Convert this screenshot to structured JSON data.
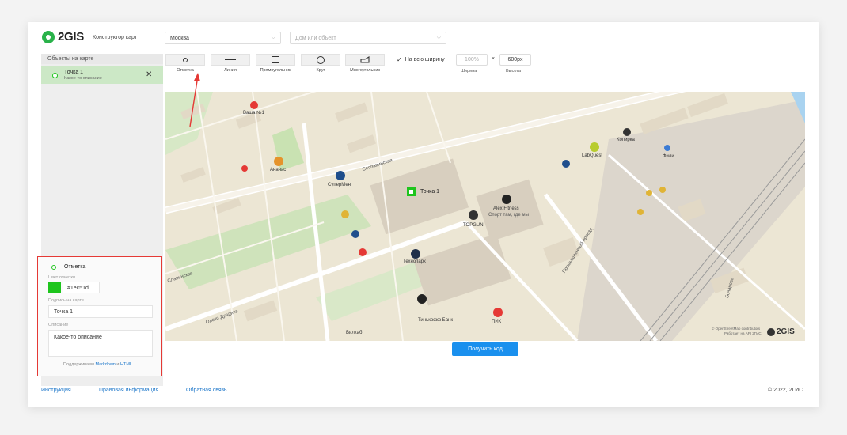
{
  "header": {
    "logo": "2GIS",
    "subtitle": "Конструктор карт",
    "city": "Москва",
    "search_placeholder": "Дом или объект"
  },
  "sidebar": {
    "title": "Объекты на карте",
    "items": [
      {
        "title": "Точка 1",
        "description": "Какое-то описание"
      }
    ]
  },
  "tools": [
    {
      "label": "Отметка",
      "icon": "circle-dot-icon"
    },
    {
      "label": "Линия",
      "icon": "line-icon"
    },
    {
      "label": "Прямоугольник",
      "icon": "square-icon"
    },
    {
      "label": "Круг",
      "icon": "circle-icon"
    },
    {
      "label": "Многоугольник",
      "icon": "polygon-icon"
    }
  ],
  "size": {
    "full_width_label": "На всю ширину",
    "width_value": "100%",
    "times": "×",
    "height_value": "600px",
    "width_label": "Ширина",
    "height_label": "Высота"
  },
  "panel": {
    "type_label": "Отметка",
    "color_label": "Цвет отметки",
    "color_value": "#1ec51d",
    "caption_label": "Подпись на карте",
    "caption_value": "Точка 1",
    "desc_label": "Описание",
    "desc_value": "Какое-то описание",
    "support_prefix": "Поддерживаем",
    "support_md": "Markdown",
    "support_and": "и",
    "support_html": "HTML"
  },
  "map": {
    "pois": [
      "Ваша №1",
      "Ананас",
      "СуперМен",
      "Точка 1",
      "Alex Fitness",
      "Спорт там, где мы",
      "TOPGUN",
      "Технопарк",
      "Тинькофф Банк",
      "ПИК",
      "LabQuest",
      "Копирка",
      "Фили",
      "Вилкаб"
    ],
    "streets": [
      "Сеславинская",
      "Олеко Дундича",
      "Славинская",
      "Промышленный проезд",
      "Бочарова"
    ],
    "attribution": "© OpenStreetMap contributors",
    "attribution2": "Работает на API 2ГИС",
    "logo": "2GIS"
  },
  "actions": {
    "get_code": "Получить код"
  },
  "footer": {
    "links": [
      "Инструкция",
      "Правовая информация",
      "Обратная связь"
    ],
    "copyright": "© 2022, 2ГИС"
  },
  "colors": {
    "accent": "#1ec51d",
    "primary": "#1a90ee",
    "highlight": "#e53935"
  }
}
